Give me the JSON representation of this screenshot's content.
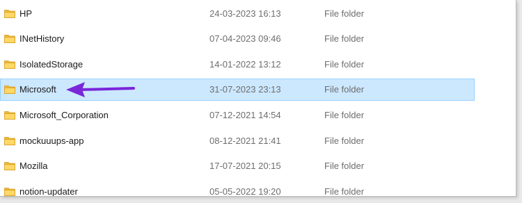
{
  "files": [
    {
      "name": "HP",
      "date_modified": "24-03-2023 16:13",
      "type": "File folder",
      "selected": false
    },
    {
      "name": "INetHistory",
      "date_modified": "07-04-2023 09:46",
      "type": "File folder",
      "selected": false
    },
    {
      "name": "IsolatedStorage",
      "date_modified": "14-01-2022 13:12",
      "type": "File folder",
      "selected": false
    },
    {
      "name": "Microsoft",
      "date_modified": "31-07-2023 23:13",
      "type": "File folder",
      "selected": true
    },
    {
      "name": "Microsoft_Corporation",
      "date_modified": "07-12-2021 14:54",
      "type": "File folder",
      "selected": false
    },
    {
      "name": "mockuuups-app",
      "date_modified": "08-12-2021 21:41",
      "type": "File folder",
      "selected": false
    },
    {
      "name": "Mozilla",
      "date_modified": "17-07-2021 20:15",
      "type": "File folder",
      "selected": false
    },
    {
      "name": "notion-updater",
      "date_modified": "05-05-2022 19:20",
      "type": "File folder",
      "selected": false
    }
  ],
  "icons": {
    "folder": "folder-icon",
    "annotation": "arrow-annotation"
  },
  "colors": {
    "selection_background": "#cce8ff",
    "selection_border": "#99d1ff",
    "annotation_arrow": "#7a26d9",
    "folder_yellow": "#f7c948"
  }
}
